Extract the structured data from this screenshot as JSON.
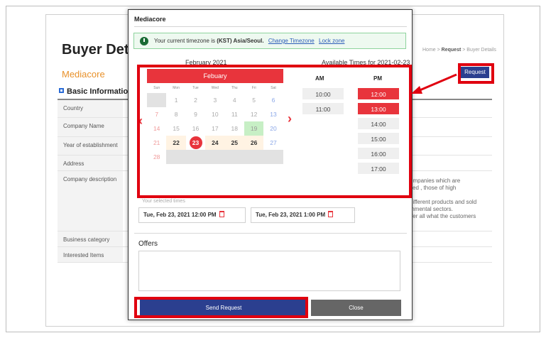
{
  "background": {
    "title": "Buyer Details",
    "breadcrumb": {
      "home": "Home",
      "request": "Request",
      "current": "Buyer Details",
      "sep": " > "
    },
    "company_name": "Mediacore",
    "request_label": "Request",
    "section_title": "Basic Information",
    "rows": [
      {
        "label": "Country"
      },
      {
        "label": "Company Name"
      },
      {
        "label": "Year of establishment"
      },
      {
        "label": "Address"
      },
      {
        "label": "Company description"
      },
      {
        "label": "Business category"
      },
      {
        "label": "Interested Items"
      }
    ],
    "description_fragments": [
      "ompanies which are",
      "sed , those of high",
      "different products and sold",
      "mmental sectors.",
      "ffer all what the customers"
    ]
  },
  "modal": {
    "title": "Mediacore",
    "timezone": {
      "prefix": "Your current timezone is ",
      "zone": "(KST) Asia/Seoul.",
      "change_link": "Change Timezone",
      "lock_link": "Lock zone"
    },
    "month_label": "February 2021",
    "available_label": "Available Times for 2021-02-23",
    "calendar": {
      "header": "Febuary",
      "weekdays": [
        "Sun",
        "Mon",
        "Tue",
        "Wed",
        "Thu",
        "Fri",
        "Sat"
      ],
      "weeks": [
        [
          {
            "d": "",
            "s": "blank"
          },
          {
            "d": "1",
            "s": ""
          },
          {
            "d": "2",
            "s": ""
          },
          {
            "d": "3",
            "s": ""
          },
          {
            "d": "4",
            "s": ""
          },
          {
            "d": "5",
            "s": ""
          },
          {
            "d": "6",
            "s": "sat"
          }
        ],
        [
          {
            "d": "7",
            "s": "sun"
          },
          {
            "d": "8",
            "s": ""
          },
          {
            "d": "9",
            "s": ""
          },
          {
            "d": "10",
            "s": ""
          },
          {
            "d": "11",
            "s": ""
          },
          {
            "d": "12",
            "s": ""
          },
          {
            "d": "13",
            "s": "sat"
          }
        ],
        [
          {
            "d": "14",
            "s": "sun"
          },
          {
            "d": "15",
            "s": ""
          },
          {
            "d": "16",
            "s": ""
          },
          {
            "d": "17",
            "s": ""
          },
          {
            "d": "18",
            "s": ""
          },
          {
            "d": "19",
            "s": "green"
          },
          {
            "d": "20",
            "s": "sat"
          }
        ],
        [
          {
            "d": "21",
            "s": "sun"
          },
          {
            "d": "22",
            "s": "avail"
          },
          {
            "d": "23",
            "s": "sel"
          },
          {
            "d": "24",
            "s": "avail"
          },
          {
            "d": "25",
            "s": "avail"
          },
          {
            "d": "26",
            "s": "avail"
          },
          {
            "d": "27",
            "s": "sat"
          }
        ],
        [
          {
            "d": "28",
            "s": "dim"
          },
          {
            "d": "",
            "s": "blank"
          },
          {
            "d": "",
            "s": "blank"
          },
          {
            "d": "",
            "s": "blank"
          },
          {
            "d": "",
            "s": "blank"
          },
          {
            "d": "",
            "s": "blank"
          },
          {
            "d": "",
            "s": "blank"
          }
        ]
      ]
    },
    "am_label": "AM",
    "pm_label": "PM",
    "am_slots": [
      {
        "time": "10:00",
        "selected": false
      },
      {
        "time": "11:00",
        "selected": false
      }
    ],
    "pm_slots": [
      {
        "time": "12:00",
        "selected": true
      },
      {
        "time": "13:00",
        "selected": true
      },
      {
        "time": "14:00",
        "selected": false
      },
      {
        "time": "15:00",
        "selected": false
      },
      {
        "time": "16:00",
        "selected": false
      },
      {
        "time": "17:00",
        "selected": false
      }
    ],
    "selected_times_label": "Your selected times",
    "selected_times": [
      "Tue, Feb 23, 2021 12:00 PM",
      "Tue, Feb 23, 2021 1:00 PM"
    ],
    "offers_label": "Offers",
    "offers_value": "",
    "send_label": "Send Request",
    "close_label": "Close"
  },
  "colors": {
    "accent_red": "#e8343c",
    "primary_blue": "#2b3f8f",
    "highlight_red": "#e0000f",
    "company_orange": "#e8912a"
  }
}
